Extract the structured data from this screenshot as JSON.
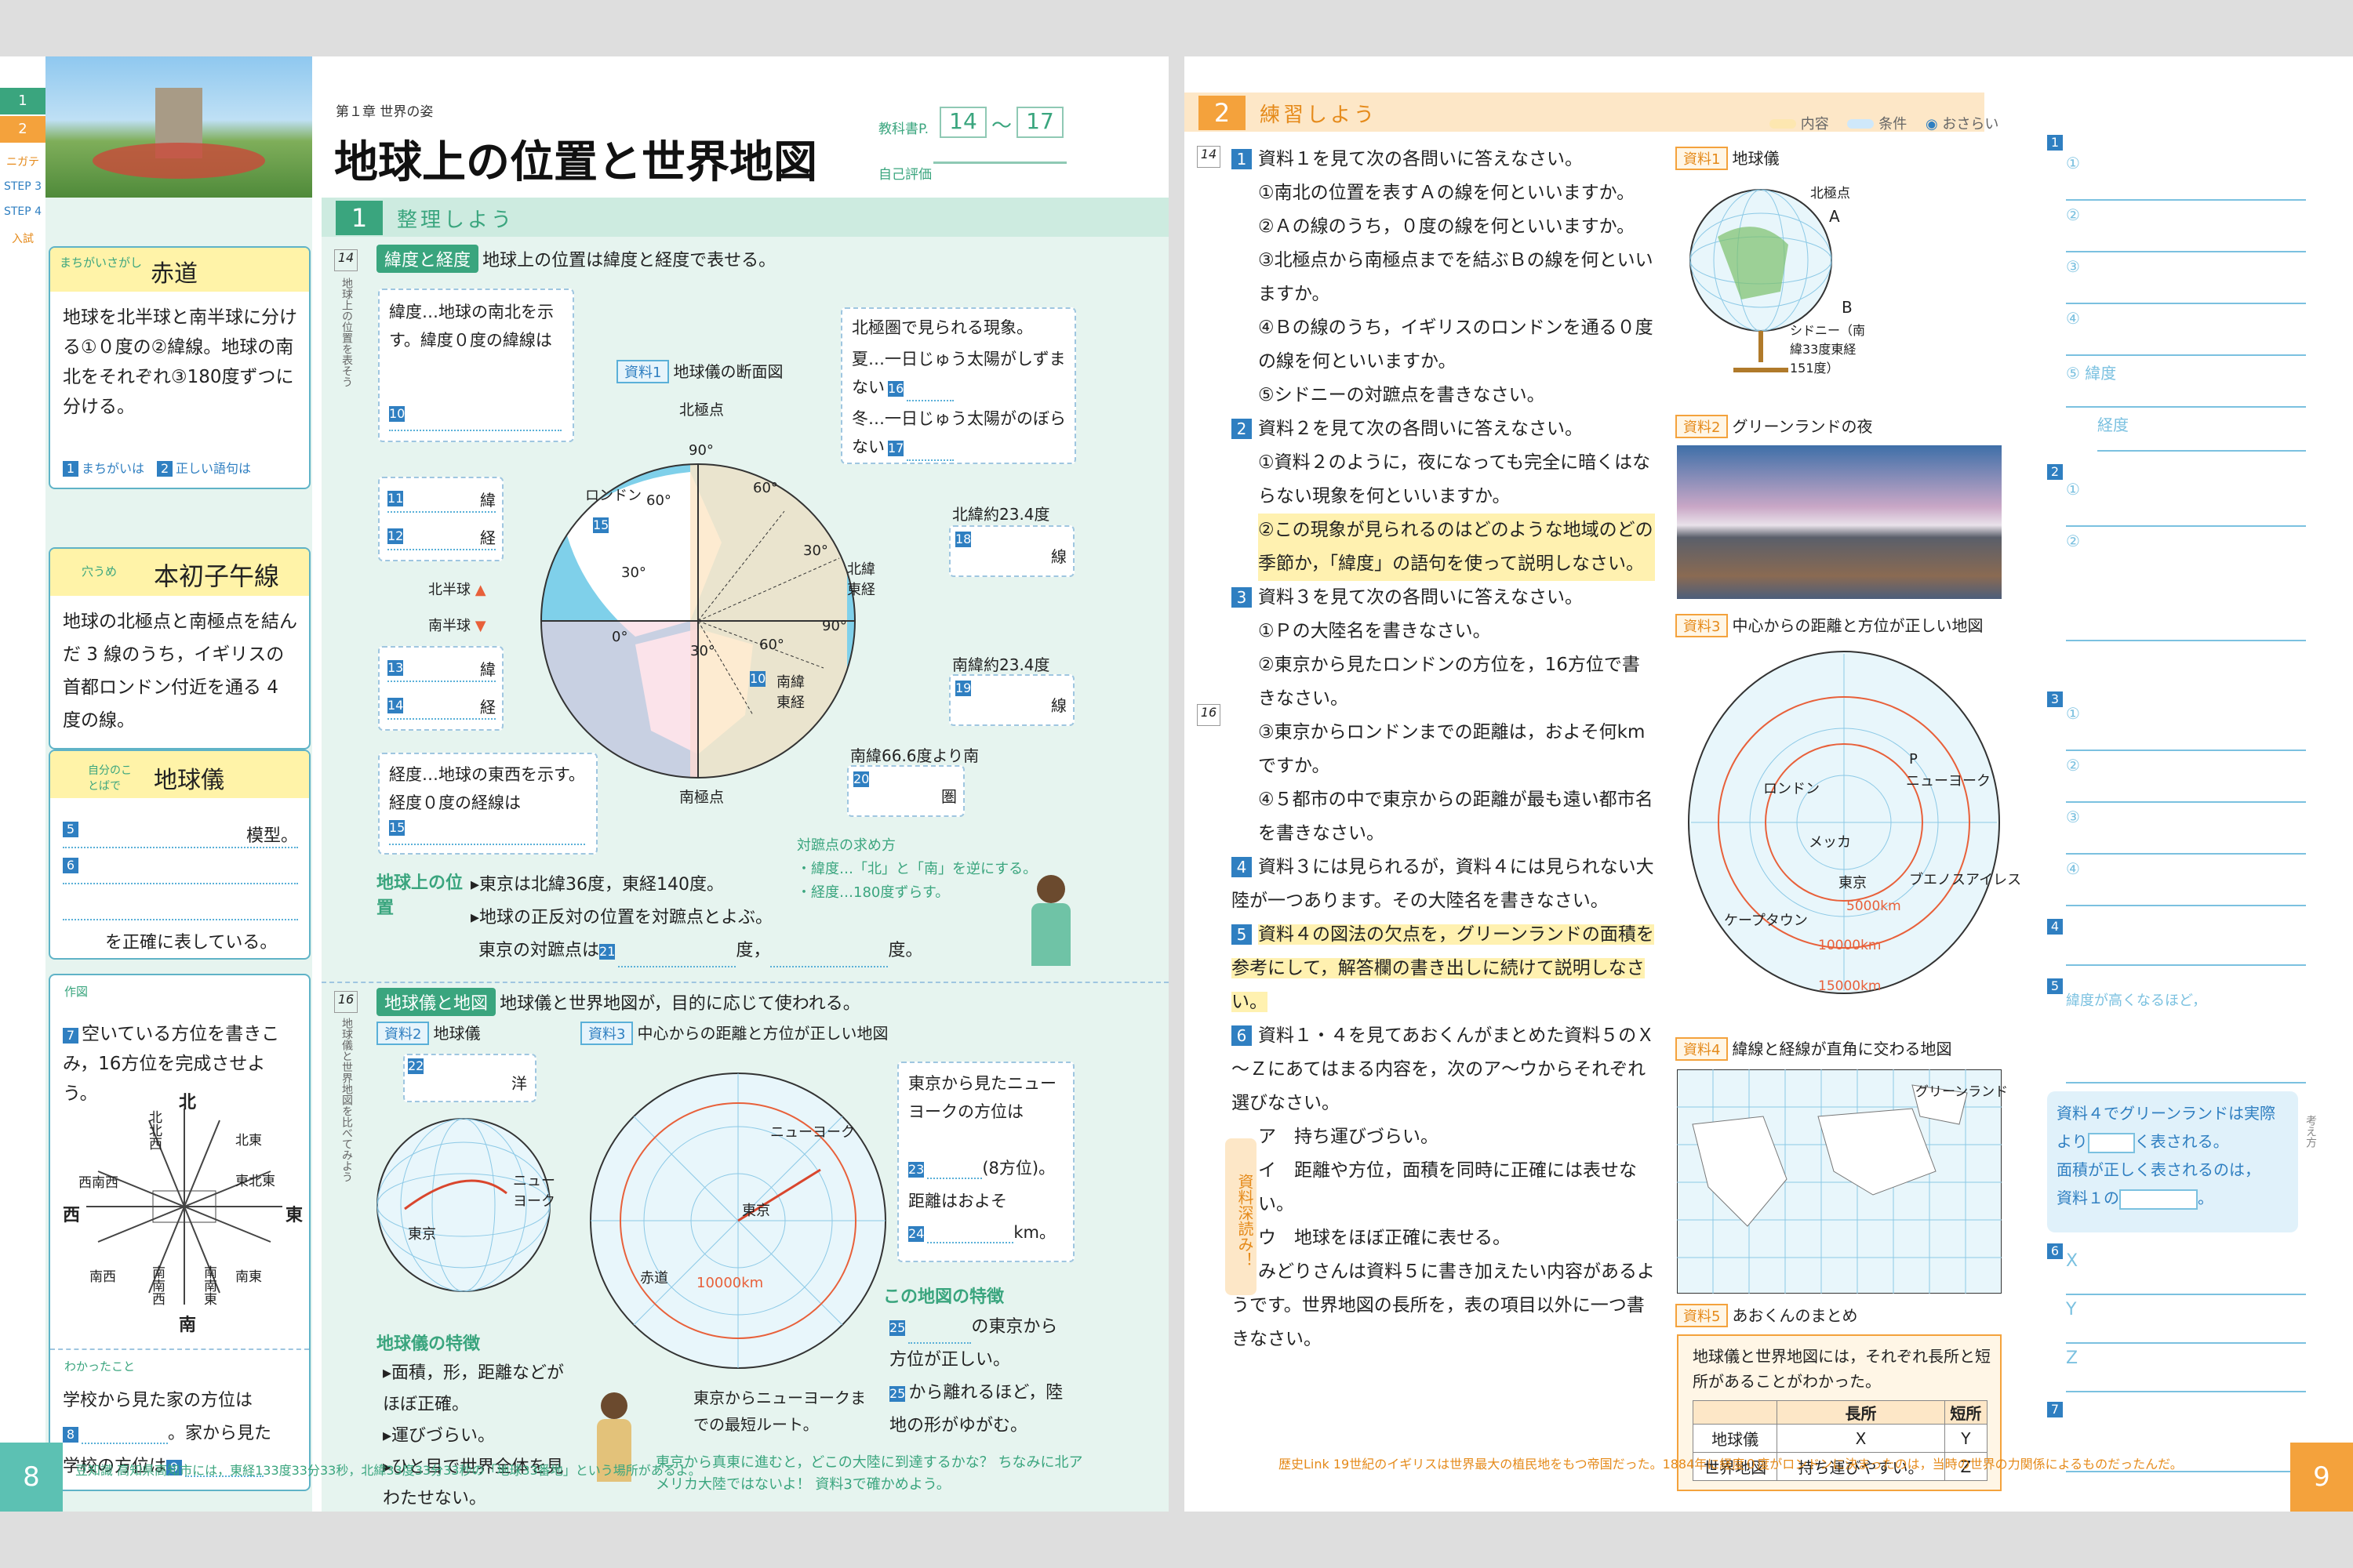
{
  "left": {
    "chapter": "第１章 世界の姿",
    "title": "地球上の位置と世界地図",
    "textbook_label": "教科書P.",
    "textbook_from": "14",
    "textbook_to": "17",
    "self_eval": "自己評価",
    "step_tabs": [
      "1 STEP",
      "2 STEP",
      "ニガテ",
      "STEP 3",
      "STEP 4",
      "入試"
    ],
    "step_heading": "整理しよう",
    "box1_tag": "まちがいさがし",
    "box1_title": "赤道",
    "box1_text": "地球を北半球と南半球に分ける①０度の②緯線。地球の南北をそれぞれ③180度ずつに分ける。",
    "box1_legend1": "まちがいは",
    "box1_legend2": "正しい語句は",
    "box2_tag": "穴うめ",
    "box2_title": "本初子午線",
    "box2_text": "地球の北極点と南極点を結んだ 3 線のうち，イギリスの首都ロンドン付近を通る 4 度の線。",
    "box3_tag": "自分のことばで",
    "box3_title": "地球儀",
    "box3_line1": "模型。",
    "box3_line3": "を正確に表している。",
    "box4_tag": "作図",
    "box4_text": "空いている方位を書きこみ，16方位を完成させよう。",
    "compass": {
      "n": "北",
      "s": "南",
      "e": "東",
      "w": "西",
      "nnw": "北北西",
      "ne": "北東",
      "ene": "東北東",
      "wsw": "西南西",
      "sw": "南西",
      "ssw": "南南西",
      "sse": "南南東",
      "se": "南東",
      "q7": "7"
    },
    "wakatta_label": "わかったこと",
    "wakatta_text1": "学校から見た家の方位は",
    "wakatta_text2": "。家から見た",
    "wakatta_text3": "学校の方位は",
    "sec1_page": "14",
    "sec1_side": "地球上の位置を表そう",
    "sec1_tag": "緯度と経度",
    "sec1_text": "地球上の位置は緯度と経度で表せる。",
    "lat_box": "緯度…地球の南北を示す。緯度０度の緯線は",
    "arctic_box": "北極圏で見られる現象。",
    "arctic_summer": "夏…一日じゅう太陽がしずまない",
    "arctic_winter": "冬…一日じゅう太陽がのぼらない",
    "shiryo1": "資料1",
    "shiryo1_title": "地球儀の断面図",
    "north_pole": "北極点",
    "south_pole": "南極点",
    "london": "ロンドン",
    "lat_labels": [
      "90°",
      "60°",
      "30°",
      "0°",
      "30°",
      "60°",
      "90°",
      "60°",
      "30°"
    ],
    "n_hemi": "北半球",
    "s_hemi": "南半球",
    "lat11": "緯",
    "lon12": "経",
    "lat13": "緯",
    "lon14": "経",
    "hokui_keido": "北緯東経",
    "nanki_tokei": "南緯東経",
    "n234": "北緯約23.4度",
    "s234": "南緯約23.4度",
    "s666": "南緯66.6度より南",
    "line18": "線",
    "line19": "線",
    "ken20": "圏",
    "lon_box": "経度…地球の東西を示す。経度０度の経線は",
    "taisho_title": "対蹠点の求め方",
    "taisho1": "・緯度…「北」と「南」を逆にする。",
    "taisho2": "・経度…180度ずらす。",
    "ichi_title": "地球上の位置",
    "ichi1": "東京は北緯36度，東経140度。",
    "ichi2": "地球の正反対の位置を対蹠点とよぶ。",
    "ichi3": "東京の対蹠点は",
    "do": "度，",
    "do2": "度。",
    "sec2_page": "16",
    "sec2_side": "地球儀と世界地図を比べてみよう",
    "sec2_tag": "地球儀と地図",
    "sec2_text": "地球儀と世界地図が，目的に応じて使われる。",
    "shiryo2": "資料2",
    "shiryo2_title": "地球儀",
    "shiryo3": "資料3",
    "shiryo3_title": "中心からの距離と方位が正しい地図",
    "ocean22": "洋",
    "tokyo": "東京",
    "newyork": "ニューヨーク",
    "equator": "赤道",
    "km10000": "10000km",
    "ny_box1": "東京から見たニューヨークの方位は",
    "ny_box2": "(8方位)。",
    "ny_box3": "距離はおよそ",
    "ny_box4": "km。",
    "route": "東京からニューヨークまでの最短ルート。",
    "globe_feat_title": "地球儀の特徴",
    "globe_feat1": "面積，形，距離などがほぼ正確。",
    "globe_feat2": "運びづらい。",
    "globe_feat3": "ひと目で世界全体を見わたせない。",
    "map_feat_title": "この地図の特徴",
    "map_feat1": "の東京から",
    "map_feat2": "方位が正しい。",
    "map_feat3": "から離れるほど，陸地の形がゆがむ。",
    "bottom_note": "東京から真東に進むと，どこの大陸に到達するかな？ ちなみに北アメリカ大陸ではないよ！ 資料3で確かめよう。",
    "page_num": "8",
    "footer": "豆知識 高知県高知市には，東経133度33分33秒，北緯33度33分33秒の「地球33番地」という場所があるよ。"
  },
  "right": {
    "step_label": "2",
    "step_heading": "練習しよう",
    "legend": [
      "内容",
      "条件",
      "おさらい"
    ],
    "q1_page": "14",
    "q1": "資料１を見て次の各問いに答えなさい。",
    "q1_items": [
      "①南北の位置を表すＡの線を何といいますか。",
      "②Ａの線のうち，０度の線を何といいますか。",
      "③北極点から南極点までを結ぶＢの線を何といいますか。",
      "④Ｂの線のうち，イギリスのロンドンを通る０度の線を何といいますか。",
      "⑤シドニーの対蹠点を書きなさい。"
    ],
    "q2": "資料２を見て次の各問いに答えなさい。",
    "q2_items": [
      "①資料２のように，夜になっても完全に暗くはならない現象を何といいますか。",
      "②この現象が見られるのはどのような地域のどの季節か，「緯度」の語句を使って説明しなさい。"
    ],
    "q3_page": "16",
    "q3": "資料３を見て次の各問いに答えなさい。",
    "q3_items": [
      "①Ｐの大陸名を書きなさい。",
      "②東京から見たロンドンの方位を，16方位で書きなさい。",
      "③東京からロンドンまでの距離は，およそ何kmですか。",
      "④５都市の中で東京からの距離が最も遠い都市名を書きなさい。"
    ],
    "q4": "資料３には見られるが，資料４には見られない大陸が一つあります。その大陸名を書きなさい。",
    "q5": "資料４の図法の欠点を，グリーンランドの面積を参考にして，解答欄の書き出しに続けて説明しなさい。",
    "q6": "資料１・４を見てあおくんがまとめた資料５のＸ～Ｚにあてはまる内容を，次のア～ウからそれぞれ選びなさい。",
    "q6_a": "ア　持ち運びづらい。",
    "q6_i": "イ　距離や方位，面積を同時に正確には表せない。",
    "q6_u": "ウ　地球をほぼ正確に表せる。",
    "q7": "みどりさんは資料５に書き加えたい内容があるようです。世界地図の長所を，表の項目以外に一つ書きなさい。",
    "fukayomi": "資料深読み！",
    "sr1": "資料1",
    "sr1_title": "地球儀",
    "sr1_north": "北極点",
    "sr1_a": "A",
    "sr1_b": "B",
    "sydney": "シドニー（南緯33度東経151度）",
    "sr2": "資料2",
    "sr2_title": "グリーンランドの夜",
    "sr3": "資料3",
    "sr3_title": "中心からの距離と方位が正しい地図",
    "sr3_cities": [
      "P",
      "ロンドン",
      "ニューヨーク",
      "メッカ",
      "東京",
      "ブエノスアイレス",
      "ケープタウン"
    ],
    "sr3_km": [
      "5000km",
      "10000km",
      "15000km"
    ],
    "sr4": "資料4",
    "sr4_title": "緯線と経線が直角に交わる地図",
    "sr4_greenland": "グリーンランド",
    "sr5": "資料5",
    "sr5_title": "あおくんのまとめ",
    "sr5_text": "地球儀と世界地図には，それぞれ長所と短所があることがわかった。",
    "table": {
      "headers": [
        "",
        "長所",
        "短所"
      ],
      "rows": [
        [
          "地球儀",
          "X",
          "Y"
        ],
        [
          "世界地図",
          "持ち運びやすい。",
          "Z"
        ]
      ]
    },
    "ans": {
      "h1": "1",
      "h2": "2",
      "h3": "3",
      "h4": "4",
      "h5": "5",
      "h6": "6",
      "h7": "7",
      "c1": [
        "①",
        "②",
        "③",
        "④",
        "⑤ 緯度",
        "経度"
      ],
      "c2": [
        "①",
        "②"
      ],
      "c3": [
        "①",
        "②",
        "③",
        "④"
      ],
      "c5": "緯度が高くなるほど，",
      "c6": [
        "X",
        "Y",
        "Z"
      ]
    },
    "hint1": "資料４でグリーンランドは実際より",
    "hint2": "く表される。",
    "hint3": "面積が正しく表されるのは，",
    "hint4": "資料１の",
    "kangaekata": "考え方",
    "page_num": "9",
    "footer": "歴史Link 19世紀のイギリスは世界最大の植民地をもつ帝国だった。1884年に経度０度がロンドンに決まったのは，当時の世界の力関係によるものだったんだ。"
  },
  "colors": {
    "teal": "#3aa57e",
    "blue": "#2f7fc1",
    "orange": "#f4a23c",
    "yellow": "#fff3a8"
  }
}
